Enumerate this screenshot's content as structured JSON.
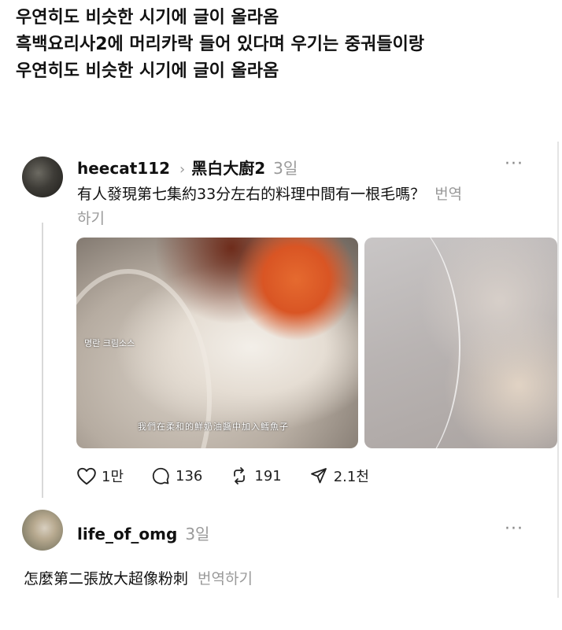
{
  "intro": {
    "lines": [
      "우연히도 비슷한 시기에 글이 올라옴",
      "흑백요리사2에 머리카락 들어 있다며 우기는 중궈들이랑",
      "우연히도 비슷한 시기에 글이 올라옴"
    ]
  },
  "post1": {
    "username": "heecat112",
    "community": "黑白大廚2",
    "time": "3일",
    "text": "有人發現第七集約33分左右的料理中間有一根毛嗎？",
    "translate_label": "번역하기",
    "image1": {
      "caption_korean": "명란 크림소스",
      "caption_chinese": "我們在柔和的鮮奶油醬中加入鱈魚子"
    },
    "actions": {
      "likes": "1만",
      "comments": "136",
      "reposts": "191",
      "shares": "2.1천"
    },
    "icons": {
      "like": "heart-icon",
      "comment": "comment-bubble-icon",
      "repost": "repost-icon",
      "share": "send-icon",
      "more": "more-icon"
    }
  },
  "post2": {
    "username": "life_of_omg",
    "time": "3일",
    "text": "怎麼第二張放大超像粉刺",
    "translate_label": "번역하기"
  }
}
